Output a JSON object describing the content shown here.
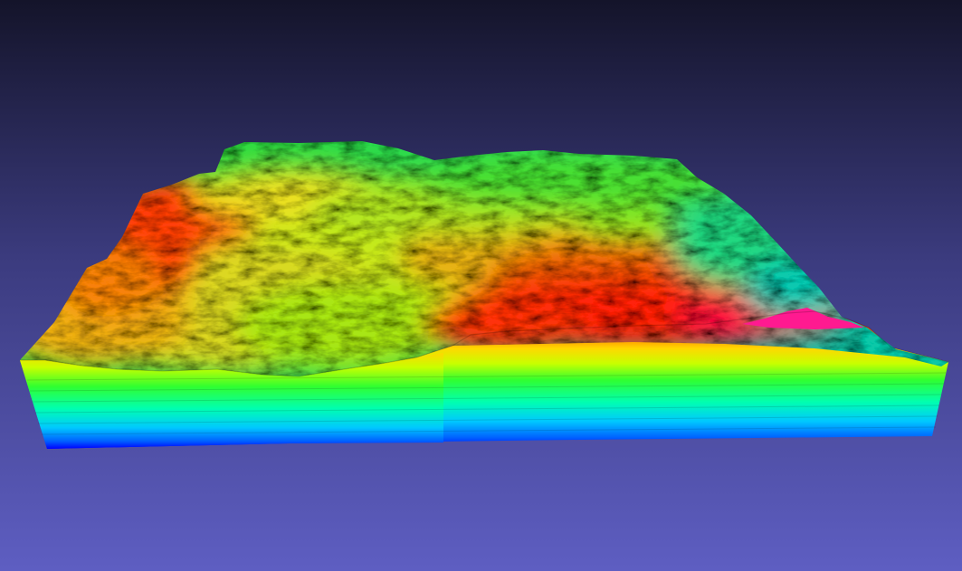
{
  "viewer": {
    "background_colors": {
      "top": "#14142a",
      "middle": "#3f3f86",
      "bottom": "#5c5cbe"
    }
  },
  "terrain": {
    "side_colormap": [
      "#0000ff",
      "#00a6ff",
      "#00ffd8",
      "#00ff30",
      "#8cff00",
      "#ffd800",
      "#ff6a00",
      "#ff0000",
      "#ff0080"
    ],
    "surface_colormap": {
      "low": "#00d8b0",
      "mid_low": "#2ee02a",
      "mid": "#c8ea20",
      "mid_high": "#f2a010",
      "high": "#ff1a10",
      "peak": "#ff1a90"
    }
  }
}
